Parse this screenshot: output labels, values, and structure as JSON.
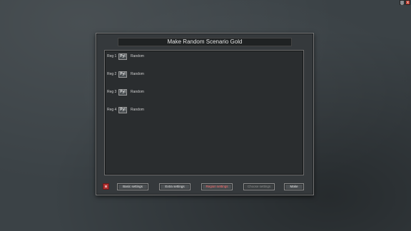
{
  "window": {
    "minimize_label": "_",
    "close_label": "x",
    "close_color": "#c0392b"
  },
  "dialog": {
    "title": "Make Random Scenario Gold"
  },
  "regions": [
    {
      "label": "Reg 1",
      "player": "Pyl",
      "value": "Random"
    },
    {
      "label": "Reg 2",
      "player": "Pyl",
      "value": "Random"
    },
    {
      "label": "Reg 3",
      "player": "Pyl",
      "value": "Random"
    },
    {
      "label": "Reg 4",
      "player": "Pyl",
      "value": "Random"
    }
  ],
  "buttons": {
    "basic": "Basic settings",
    "extra": "Extra settings",
    "region": "Region settings",
    "choose": "Choose settings",
    "make": "Make"
  },
  "icons": {
    "flag": "flag-icon"
  },
  "colors": {
    "active_tab_text": "#ff6b6b"
  }
}
